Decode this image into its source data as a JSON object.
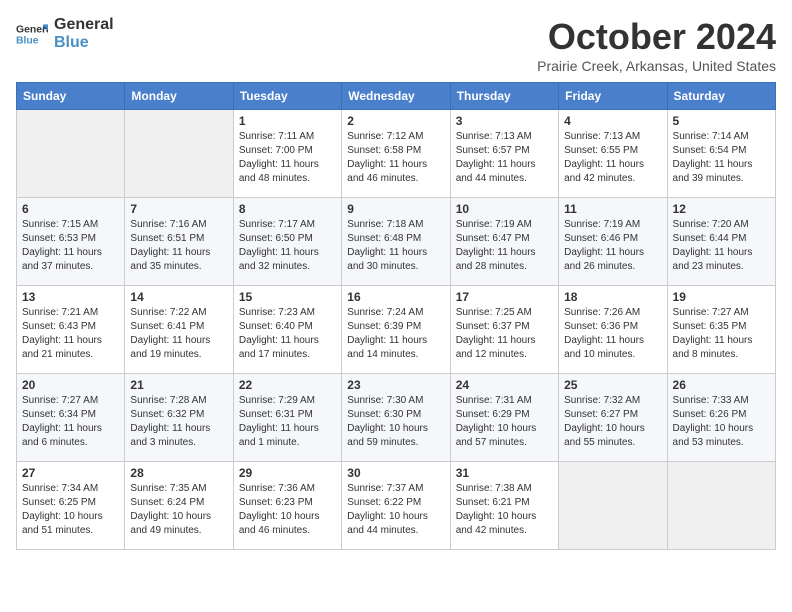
{
  "logo": {
    "line1": "General",
    "line2": "Blue"
  },
  "title": "October 2024",
  "subtitle": "Prairie Creek, Arkansas, United States",
  "headers": [
    "Sunday",
    "Monday",
    "Tuesday",
    "Wednesday",
    "Thursday",
    "Friday",
    "Saturday"
  ],
  "weeks": [
    [
      {
        "day": "",
        "info": ""
      },
      {
        "day": "",
        "info": ""
      },
      {
        "day": "1",
        "info": "Sunrise: 7:11 AM\nSunset: 7:00 PM\nDaylight: 11 hours and 48 minutes."
      },
      {
        "day": "2",
        "info": "Sunrise: 7:12 AM\nSunset: 6:58 PM\nDaylight: 11 hours and 46 minutes."
      },
      {
        "day": "3",
        "info": "Sunrise: 7:13 AM\nSunset: 6:57 PM\nDaylight: 11 hours and 44 minutes."
      },
      {
        "day": "4",
        "info": "Sunrise: 7:13 AM\nSunset: 6:55 PM\nDaylight: 11 hours and 42 minutes."
      },
      {
        "day": "5",
        "info": "Sunrise: 7:14 AM\nSunset: 6:54 PM\nDaylight: 11 hours and 39 minutes."
      }
    ],
    [
      {
        "day": "6",
        "info": "Sunrise: 7:15 AM\nSunset: 6:53 PM\nDaylight: 11 hours and 37 minutes."
      },
      {
        "day": "7",
        "info": "Sunrise: 7:16 AM\nSunset: 6:51 PM\nDaylight: 11 hours and 35 minutes."
      },
      {
        "day": "8",
        "info": "Sunrise: 7:17 AM\nSunset: 6:50 PM\nDaylight: 11 hours and 32 minutes."
      },
      {
        "day": "9",
        "info": "Sunrise: 7:18 AM\nSunset: 6:48 PM\nDaylight: 11 hours and 30 minutes."
      },
      {
        "day": "10",
        "info": "Sunrise: 7:19 AM\nSunset: 6:47 PM\nDaylight: 11 hours and 28 minutes."
      },
      {
        "day": "11",
        "info": "Sunrise: 7:19 AM\nSunset: 6:46 PM\nDaylight: 11 hours and 26 minutes."
      },
      {
        "day": "12",
        "info": "Sunrise: 7:20 AM\nSunset: 6:44 PM\nDaylight: 11 hours and 23 minutes."
      }
    ],
    [
      {
        "day": "13",
        "info": "Sunrise: 7:21 AM\nSunset: 6:43 PM\nDaylight: 11 hours and 21 minutes."
      },
      {
        "day": "14",
        "info": "Sunrise: 7:22 AM\nSunset: 6:41 PM\nDaylight: 11 hours and 19 minutes."
      },
      {
        "day": "15",
        "info": "Sunrise: 7:23 AM\nSunset: 6:40 PM\nDaylight: 11 hours and 17 minutes."
      },
      {
        "day": "16",
        "info": "Sunrise: 7:24 AM\nSunset: 6:39 PM\nDaylight: 11 hours and 14 minutes."
      },
      {
        "day": "17",
        "info": "Sunrise: 7:25 AM\nSunset: 6:37 PM\nDaylight: 11 hours and 12 minutes."
      },
      {
        "day": "18",
        "info": "Sunrise: 7:26 AM\nSunset: 6:36 PM\nDaylight: 11 hours and 10 minutes."
      },
      {
        "day": "19",
        "info": "Sunrise: 7:27 AM\nSunset: 6:35 PM\nDaylight: 11 hours and 8 minutes."
      }
    ],
    [
      {
        "day": "20",
        "info": "Sunrise: 7:27 AM\nSunset: 6:34 PM\nDaylight: 11 hours and 6 minutes."
      },
      {
        "day": "21",
        "info": "Sunrise: 7:28 AM\nSunset: 6:32 PM\nDaylight: 11 hours and 3 minutes."
      },
      {
        "day": "22",
        "info": "Sunrise: 7:29 AM\nSunset: 6:31 PM\nDaylight: 11 hours and 1 minute."
      },
      {
        "day": "23",
        "info": "Sunrise: 7:30 AM\nSunset: 6:30 PM\nDaylight: 10 hours and 59 minutes."
      },
      {
        "day": "24",
        "info": "Sunrise: 7:31 AM\nSunset: 6:29 PM\nDaylight: 10 hours and 57 minutes."
      },
      {
        "day": "25",
        "info": "Sunrise: 7:32 AM\nSunset: 6:27 PM\nDaylight: 10 hours and 55 minutes."
      },
      {
        "day": "26",
        "info": "Sunrise: 7:33 AM\nSunset: 6:26 PM\nDaylight: 10 hours and 53 minutes."
      }
    ],
    [
      {
        "day": "27",
        "info": "Sunrise: 7:34 AM\nSunset: 6:25 PM\nDaylight: 10 hours and 51 minutes."
      },
      {
        "day": "28",
        "info": "Sunrise: 7:35 AM\nSunset: 6:24 PM\nDaylight: 10 hours and 49 minutes."
      },
      {
        "day": "29",
        "info": "Sunrise: 7:36 AM\nSunset: 6:23 PM\nDaylight: 10 hours and 46 minutes."
      },
      {
        "day": "30",
        "info": "Sunrise: 7:37 AM\nSunset: 6:22 PM\nDaylight: 10 hours and 44 minutes."
      },
      {
        "day": "31",
        "info": "Sunrise: 7:38 AM\nSunset: 6:21 PM\nDaylight: 10 hours and 42 minutes."
      },
      {
        "day": "",
        "info": ""
      },
      {
        "day": "",
        "info": ""
      }
    ]
  ]
}
